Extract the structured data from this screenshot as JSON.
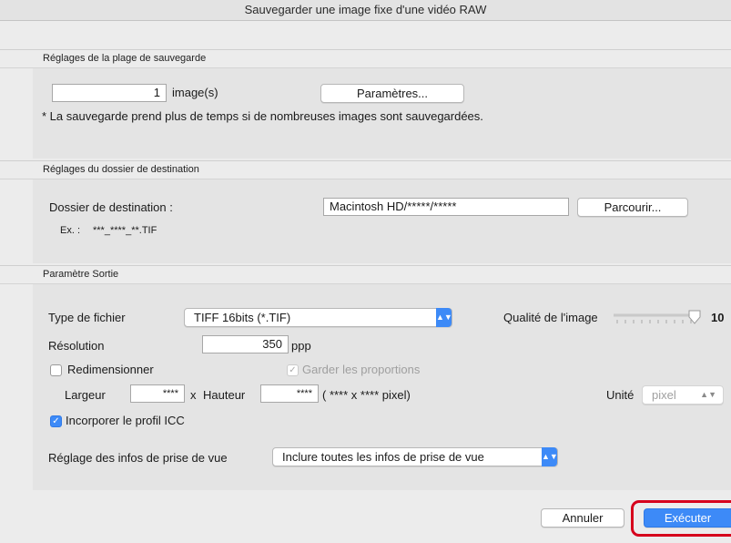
{
  "window": {
    "title": "Sauvegarder une image fixe d'une vidéo RAW"
  },
  "range_section": {
    "header": "Réglages de la plage de sauvegarde",
    "count_value": "1",
    "count_unit": "image(s)",
    "settings_button": "Paramètres...",
    "note": "* La sauvegarde prend plus de temps si de nombreuses images sont sauvegardées."
  },
  "destination_section": {
    "header": "Réglages du dossier de destination",
    "folder_label": "Dossier de destination :",
    "folder_value": "Macintosh HD/*****/*****",
    "browse_button": "Parcourir...",
    "example_label": "Ex. :",
    "example_value": "***_****_**.TIF"
  },
  "output_section": {
    "header": "Paramètre Sortie",
    "file_type_label": "Type de fichier",
    "file_type_value": "TIFF 16bits (*.TIF)",
    "quality_label": "Qualité de l'image",
    "quality_value": "10",
    "quality_level": 1.0,
    "resolution_label": "Résolution",
    "resolution_value": "350",
    "resolution_unit": "ppp",
    "resize_label": "Redimensionner",
    "resize_checked": false,
    "keep_ratio_label": "Garder les proportions",
    "width_label": "Largeur",
    "width_value": "****",
    "x_sep": "x",
    "height_label": "Hauteur",
    "height_value": "****",
    "pixel_summary": "( **** x **** pixel)",
    "unit_label": "Unité",
    "unit_value": "pixel",
    "icc_label": "Incorporer le profil ICC",
    "icc_checked": true,
    "shooting_info_label": "Réglage des infos de prise de vue",
    "shooting_info_value": "Inclure toutes les infos de prise de vue"
  },
  "footer": {
    "cancel_button": "Annuler",
    "execute_button": "Exécuter",
    "highlight_color": "#d6001c",
    "accent_color": "#3d8af7"
  }
}
